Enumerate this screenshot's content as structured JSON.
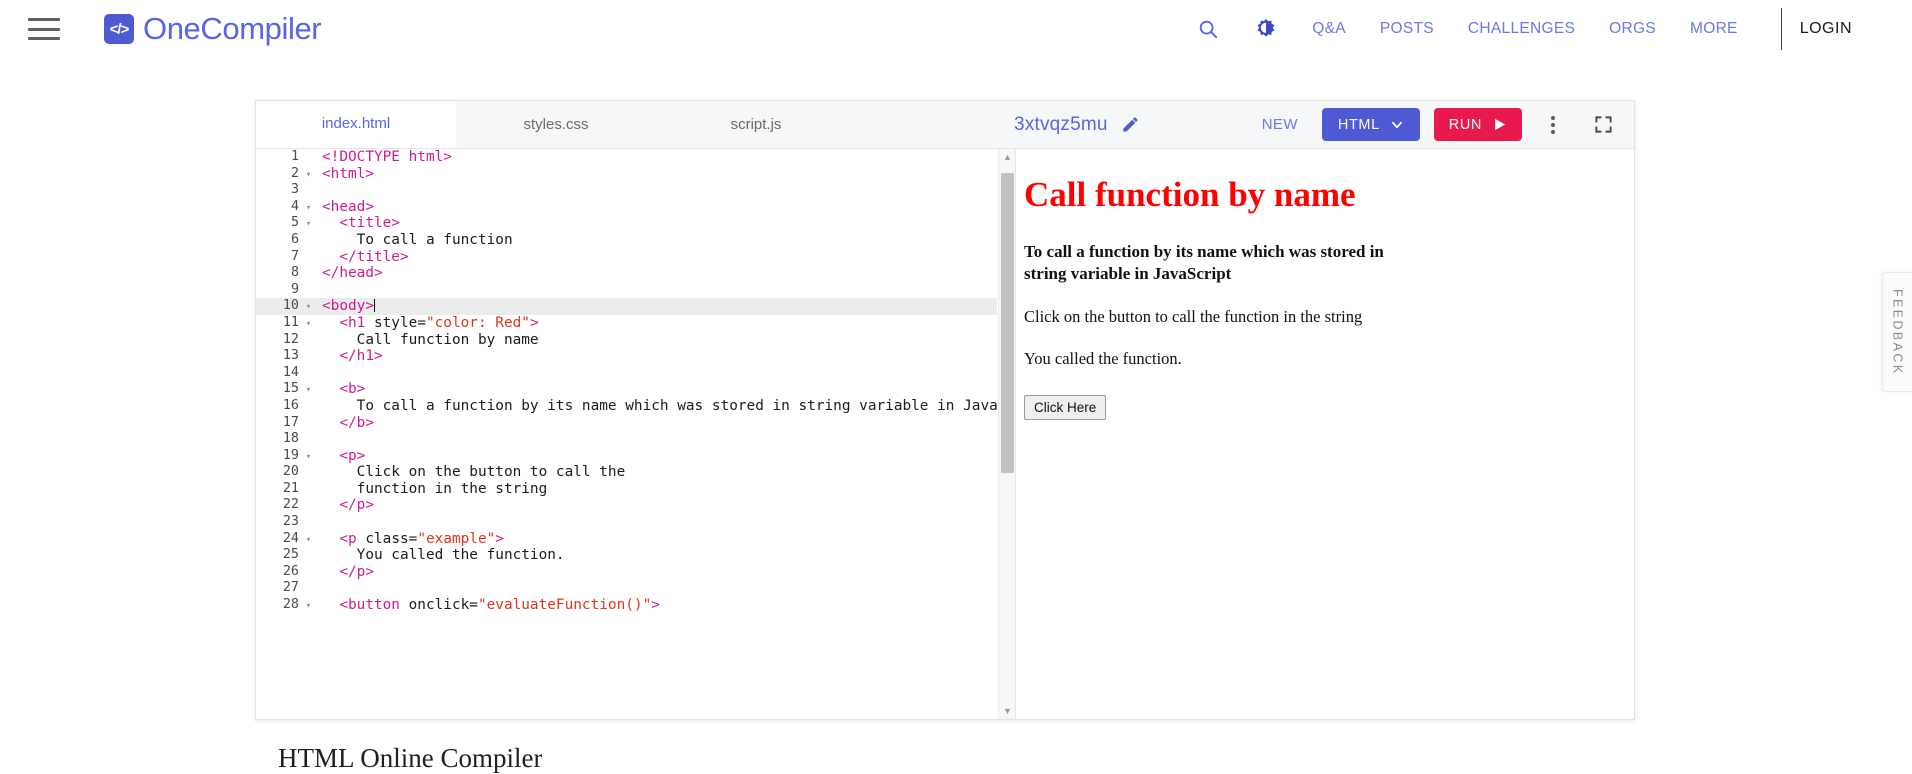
{
  "header": {
    "menu_icon": "hamburger-icon",
    "brand": {
      "mark": "</>",
      "name": "OneCompiler"
    },
    "search_icon": "search-icon",
    "theme_icon": "dark-mode-icon",
    "links": [
      "Q&A",
      "POSTS",
      "CHALLENGES",
      "ORGS",
      "MORE"
    ],
    "login_label": "LOGIN"
  },
  "ide": {
    "tabs": [
      {
        "label": "index.html",
        "active": true
      },
      {
        "label": "styles.css",
        "active": false
      },
      {
        "label": "script.js",
        "active": false
      }
    ],
    "project_name": "3xtvqz5mu",
    "edit_icon": "pencil-icon",
    "new_label": "NEW",
    "language_label": "HTML",
    "language_caret_icon": "chevron-down-icon",
    "run_label": "RUN",
    "run_icon": "play-icon",
    "more_icon": "kebab-menu-icon",
    "fullscreen_icon": "fullscreen-icon",
    "scrollbar_up_icon": "caret-up-icon",
    "scrollbar_down_icon": "caret-down-icon"
  },
  "code": {
    "active_line": 10,
    "lines": [
      {
        "n": 1,
        "fold": false,
        "indent": 0,
        "segs": [
          {
            "t": "tag",
            "v": "<!DOCTYPE html>"
          }
        ]
      },
      {
        "n": 2,
        "fold": true,
        "indent": 0,
        "segs": [
          {
            "t": "tag",
            "v": "<html>"
          }
        ]
      },
      {
        "n": 3,
        "fold": false,
        "indent": 0,
        "segs": []
      },
      {
        "n": 4,
        "fold": true,
        "indent": 0,
        "segs": [
          {
            "t": "tag",
            "v": "<head>"
          }
        ]
      },
      {
        "n": 5,
        "fold": true,
        "indent": 1,
        "segs": [
          {
            "t": "tag",
            "v": "  <title>"
          }
        ]
      },
      {
        "n": 6,
        "fold": false,
        "indent": 2,
        "segs": [
          {
            "t": "text",
            "v": "    To call a function"
          }
        ]
      },
      {
        "n": 7,
        "fold": false,
        "indent": 1,
        "segs": [
          {
            "t": "tag",
            "v": "  </title>"
          }
        ]
      },
      {
        "n": 8,
        "fold": false,
        "indent": 0,
        "segs": [
          {
            "t": "tag",
            "v": "</head>"
          }
        ]
      },
      {
        "n": 9,
        "fold": false,
        "indent": 0,
        "segs": []
      },
      {
        "n": 10,
        "fold": true,
        "indent": 0,
        "segs": [
          {
            "t": "tag",
            "v": "<body>"
          },
          {
            "t": "caret",
            "v": ""
          }
        ]
      },
      {
        "n": 11,
        "fold": true,
        "indent": 1,
        "segs": [
          {
            "t": "tag",
            "v": "  <h1 "
          },
          {
            "t": "attr",
            "v": "style="
          },
          {
            "t": "val",
            "v": "\"color: Red\""
          },
          {
            "t": "tag",
            "v": ">"
          }
        ]
      },
      {
        "n": 12,
        "fold": false,
        "indent": 2,
        "segs": [
          {
            "t": "text",
            "v": "    Call function by name"
          }
        ]
      },
      {
        "n": 13,
        "fold": false,
        "indent": 1,
        "segs": [
          {
            "t": "tag",
            "v": "  </h1>"
          }
        ]
      },
      {
        "n": 14,
        "fold": false,
        "indent": 0,
        "segs": []
      },
      {
        "n": 15,
        "fold": true,
        "indent": 1,
        "segs": [
          {
            "t": "tag",
            "v": "  <b>"
          }
        ]
      },
      {
        "n": 16,
        "fold": false,
        "indent": 2,
        "segs": [
          {
            "t": "text",
            "v": "    To call a function by its name which was stored in string variable in JavaScript"
          }
        ]
      },
      {
        "n": 17,
        "fold": false,
        "indent": 1,
        "segs": [
          {
            "t": "tag",
            "v": "  </b>"
          }
        ]
      },
      {
        "n": 18,
        "fold": false,
        "indent": 0,
        "segs": []
      },
      {
        "n": 19,
        "fold": true,
        "indent": 1,
        "segs": [
          {
            "t": "tag",
            "v": "  <p>"
          }
        ]
      },
      {
        "n": 20,
        "fold": false,
        "indent": 2,
        "segs": [
          {
            "t": "text",
            "v": "    Click on the button to call the"
          }
        ]
      },
      {
        "n": 21,
        "fold": false,
        "indent": 2,
        "segs": [
          {
            "t": "text",
            "v": "    function in the string"
          }
        ]
      },
      {
        "n": 22,
        "fold": false,
        "indent": 1,
        "segs": [
          {
            "t": "tag",
            "v": "  </p>"
          }
        ]
      },
      {
        "n": 23,
        "fold": false,
        "indent": 0,
        "segs": []
      },
      {
        "n": 24,
        "fold": true,
        "indent": 1,
        "segs": [
          {
            "t": "tag",
            "v": "  <p "
          },
          {
            "t": "attr",
            "v": "class="
          },
          {
            "t": "val",
            "v": "\"example\""
          },
          {
            "t": "tag",
            "v": ">"
          }
        ]
      },
      {
        "n": 25,
        "fold": false,
        "indent": 2,
        "segs": [
          {
            "t": "text",
            "v": "    You called the function."
          }
        ]
      },
      {
        "n": 26,
        "fold": false,
        "indent": 1,
        "segs": [
          {
            "t": "tag",
            "v": "  </p>"
          }
        ]
      },
      {
        "n": 27,
        "fold": false,
        "indent": 0,
        "segs": []
      },
      {
        "n": 28,
        "fold": true,
        "indent": 1,
        "segs": [
          {
            "t": "tag",
            "v": "  <button "
          },
          {
            "t": "attr",
            "v": "onclick="
          },
          {
            "t": "val",
            "v": "\"evaluateFunction()\""
          },
          {
            "t": "tag",
            "v": ">"
          }
        ]
      }
    ]
  },
  "preview": {
    "heading": "Call function by name",
    "heading_color": "#ff0000",
    "bold_text": "To call a function by its name which was stored in string variable in JavaScript",
    "paragraph_1": "Click on the button to call the function in the string",
    "paragraph_2": "You called the function.",
    "button_label": "Click Here"
  },
  "feedback": {
    "label": "FEEDBACK"
  },
  "below": {
    "heading": "HTML Online Compiler"
  },
  "colors": {
    "brand_blue": "#5566e6",
    "button_blue": "#4f5bd5",
    "run_red": "#e8194f",
    "tag_pink": "#d01b8f",
    "attr_value_red": "#e0341c"
  }
}
